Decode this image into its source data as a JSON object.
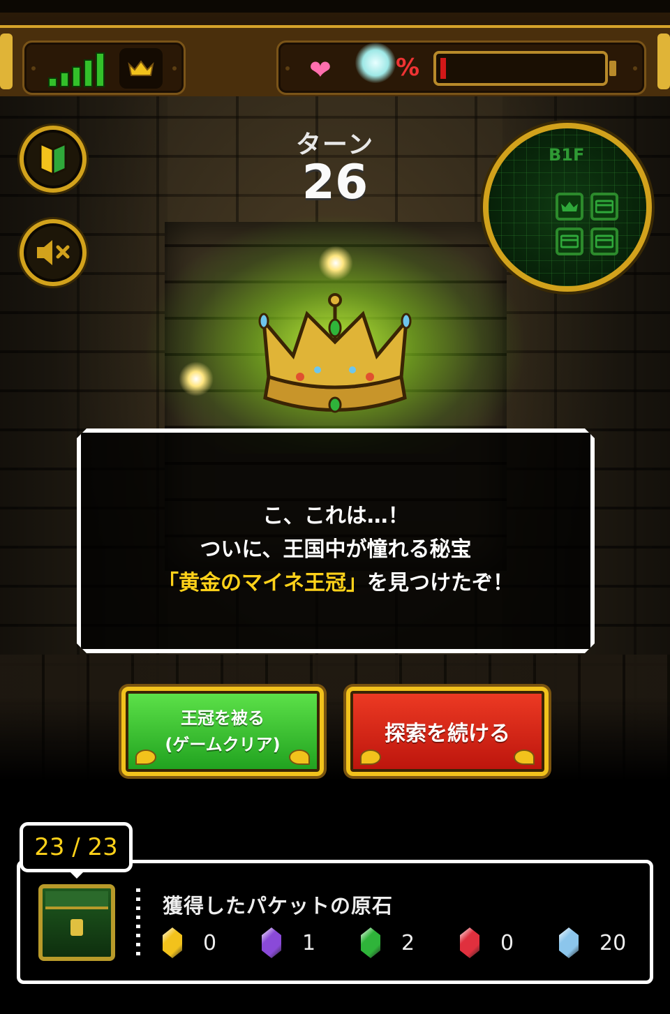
{
  "hud": {
    "signal_bars": 5,
    "crown_icon": "crown-icon",
    "heart_icon": "heart-icon",
    "percent_symbol": "%",
    "gauge_level": 0.03,
    "gauge_color": "#d21818"
  },
  "controls": {
    "beginner_icon": "beginner-mark-icon",
    "mute_icon": "speaker-muted-icon"
  },
  "turn": {
    "label": "ターン",
    "value": "26"
  },
  "minimap": {
    "floor": "B1F"
  },
  "dialog": {
    "line1": "こ、これは…！",
    "line2": "ついに、王国中が憧れる秘宝",
    "line3_highlight": "「黄金のマイネ王冠」",
    "line3_rest": "を見つけたぞ！",
    "highlight_color": "#ffd21a"
  },
  "buttons": {
    "clear_line1": "王冠を被る",
    "clear_line2": "(ゲームクリア)",
    "continue": "探索を続ける",
    "clear_color": "#3ec42e",
    "continue_color": "#d62414"
  },
  "stones": {
    "counter": "23 / 23",
    "title": "獲得したパケットの原石",
    "items": [
      {
        "name": "gold-stone",
        "color": "#f2c21c",
        "count": "0"
      },
      {
        "name": "rainbow-stone",
        "color": "#8a4ad8",
        "count": "1"
      },
      {
        "name": "green-stone",
        "color": "#2fb43a",
        "count": "2"
      },
      {
        "name": "red-stone",
        "color": "#e0303e",
        "count": "0"
      },
      {
        "name": "blue-stone",
        "color": "#8cc6ec",
        "count": "20"
      }
    ]
  }
}
